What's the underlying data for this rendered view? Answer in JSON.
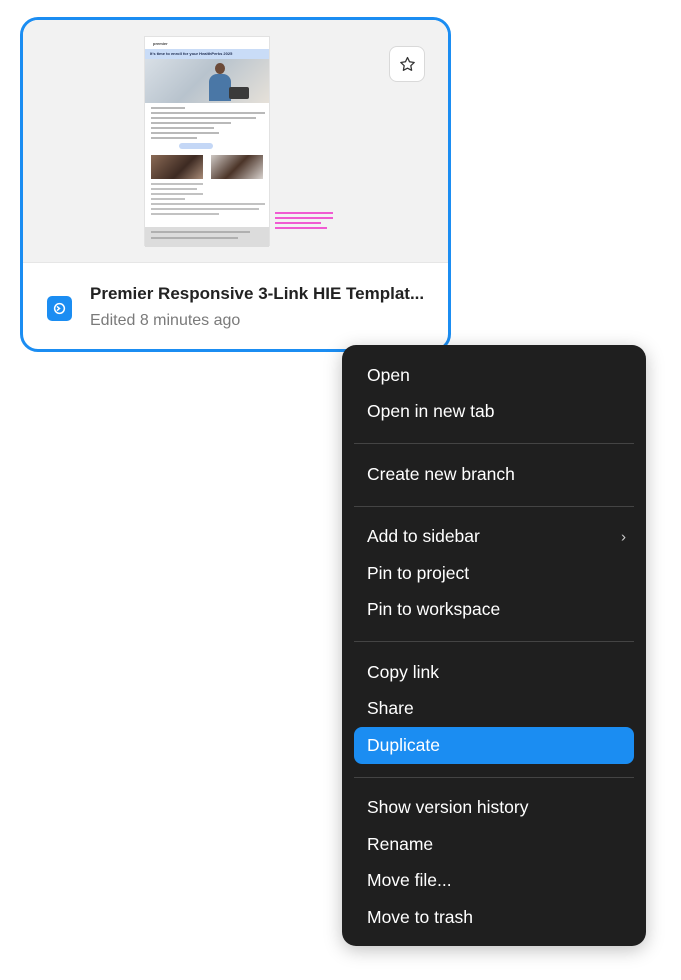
{
  "file": {
    "title": "Premier Responsive 3-Link HIE Templat...",
    "subtitle": "Edited 8 minutes ago",
    "favorite_icon": "star-icon",
    "type_icon": "prototype-file-icon",
    "thumbnail": {
      "logo": "premier",
      "banner": "It's time to enroll for your HealthPerks 2025"
    }
  },
  "menu": {
    "groups": [
      [
        {
          "label": "Open"
        },
        {
          "label": "Open in new tab"
        }
      ],
      [
        {
          "label": "Create new branch"
        }
      ],
      [
        {
          "label": "Add to sidebar",
          "submenu": "›"
        },
        {
          "label": "Pin to project"
        },
        {
          "label": "Pin to workspace"
        }
      ],
      [
        {
          "label": "Copy link"
        },
        {
          "label": "Share"
        },
        {
          "label": "Duplicate",
          "active": true
        }
      ],
      [
        {
          "label": "Show version history"
        },
        {
          "label": "Rename"
        },
        {
          "label": "Move file..."
        },
        {
          "label": "Move to trash"
        }
      ]
    ]
  },
  "colors": {
    "accent": "#1b8df2",
    "menu_bg": "#1f1f1f",
    "divider": "#444444"
  }
}
